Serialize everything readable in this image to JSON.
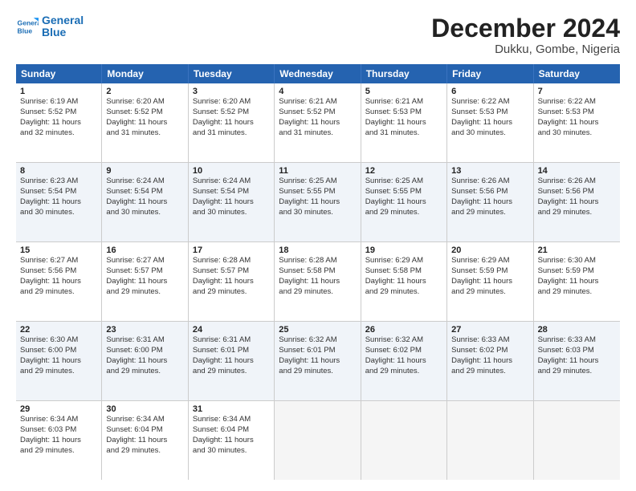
{
  "logo": {
    "text_general": "General",
    "text_blue": "Blue"
  },
  "title": "December 2024",
  "location": "Dukku, Gombe, Nigeria",
  "days_of_week": [
    "Sunday",
    "Monday",
    "Tuesday",
    "Wednesday",
    "Thursday",
    "Friday",
    "Saturday"
  ],
  "rows": [
    {
      "alt": false,
      "cells": [
        {
          "day": "1",
          "lines": [
            "Sunrise: 6:19 AM",
            "Sunset: 5:52 PM",
            "Daylight: 11 hours",
            "and 32 minutes."
          ]
        },
        {
          "day": "2",
          "lines": [
            "Sunrise: 6:20 AM",
            "Sunset: 5:52 PM",
            "Daylight: 11 hours",
            "and 31 minutes."
          ]
        },
        {
          "day": "3",
          "lines": [
            "Sunrise: 6:20 AM",
            "Sunset: 5:52 PM",
            "Daylight: 11 hours",
            "and 31 minutes."
          ]
        },
        {
          "day": "4",
          "lines": [
            "Sunrise: 6:21 AM",
            "Sunset: 5:52 PM",
            "Daylight: 11 hours",
            "and 31 minutes."
          ]
        },
        {
          "day": "5",
          "lines": [
            "Sunrise: 6:21 AM",
            "Sunset: 5:53 PM",
            "Daylight: 11 hours",
            "and 31 minutes."
          ]
        },
        {
          "day": "6",
          "lines": [
            "Sunrise: 6:22 AM",
            "Sunset: 5:53 PM",
            "Daylight: 11 hours",
            "and 30 minutes."
          ]
        },
        {
          "day": "7",
          "lines": [
            "Sunrise: 6:22 AM",
            "Sunset: 5:53 PM",
            "Daylight: 11 hours",
            "and 30 minutes."
          ]
        }
      ]
    },
    {
      "alt": true,
      "cells": [
        {
          "day": "8",
          "lines": [
            "Sunrise: 6:23 AM",
            "Sunset: 5:54 PM",
            "Daylight: 11 hours",
            "and 30 minutes."
          ]
        },
        {
          "day": "9",
          "lines": [
            "Sunrise: 6:24 AM",
            "Sunset: 5:54 PM",
            "Daylight: 11 hours",
            "and 30 minutes."
          ]
        },
        {
          "day": "10",
          "lines": [
            "Sunrise: 6:24 AM",
            "Sunset: 5:54 PM",
            "Daylight: 11 hours",
            "and 30 minutes."
          ]
        },
        {
          "day": "11",
          "lines": [
            "Sunrise: 6:25 AM",
            "Sunset: 5:55 PM",
            "Daylight: 11 hours",
            "and 30 minutes."
          ]
        },
        {
          "day": "12",
          "lines": [
            "Sunrise: 6:25 AM",
            "Sunset: 5:55 PM",
            "Daylight: 11 hours",
            "and 29 minutes."
          ]
        },
        {
          "day": "13",
          "lines": [
            "Sunrise: 6:26 AM",
            "Sunset: 5:56 PM",
            "Daylight: 11 hours",
            "and 29 minutes."
          ]
        },
        {
          "day": "14",
          "lines": [
            "Sunrise: 6:26 AM",
            "Sunset: 5:56 PM",
            "Daylight: 11 hours",
            "and 29 minutes."
          ]
        }
      ]
    },
    {
      "alt": false,
      "cells": [
        {
          "day": "15",
          "lines": [
            "Sunrise: 6:27 AM",
            "Sunset: 5:56 PM",
            "Daylight: 11 hours",
            "and 29 minutes."
          ]
        },
        {
          "day": "16",
          "lines": [
            "Sunrise: 6:27 AM",
            "Sunset: 5:57 PM",
            "Daylight: 11 hours",
            "and 29 minutes."
          ]
        },
        {
          "day": "17",
          "lines": [
            "Sunrise: 6:28 AM",
            "Sunset: 5:57 PM",
            "Daylight: 11 hours",
            "and 29 minutes."
          ]
        },
        {
          "day": "18",
          "lines": [
            "Sunrise: 6:28 AM",
            "Sunset: 5:58 PM",
            "Daylight: 11 hours",
            "and 29 minutes."
          ]
        },
        {
          "day": "19",
          "lines": [
            "Sunrise: 6:29 AM",
            "Sunset: 5:58 PM",
            "Daylight: 11 hours",
            "and 29 minutes."
          ]
        },
        {
          "day": "20",
          "lines": [
            "Sunrise: 6:29 AM",
            "Sunset: 5:59 PM",
            "Daylight: 11 hours",
            "and 29 minutes."
          ]
        },
        {
          "day": "21",
          "lines": [
            "Sunrise: 6:30 AM",
            "Sunset: 5:59 PM",
            "Daylight: 11 hours",
            "and 29 minutes."
          ]
        }
      ]
    },
    {
      "alt": true,
      "cells": [
        {
          "day": "22",
          "lines": [
            "Sunrise: 6:30 AM",
            "Sunset: 6:00 PM",
            "Daylight: 11 hours",
            "and 29 minutes."
          ]
        },
        {
          "day": "23",
          "lines": [
            "Sunrise: 6:31 AM",
            "Sunset: 6:00 PM",
            "Daylight: 11 hours",
            "and 29 minutes."
          ]
        },
        {
          "day": "24",
          "lines": [
            "Sunrise: 6:31 AM",
            "Sunset: 6:01 PM",
            "Daylight: 11 hours",
            "and 29 minutes."
          ]
        },
        {
          "day": "25",
          "lines": [
            "Sunrise: 6:32 AM",
            "Sunset: 6:01 PM",
            "Daylight: 11 hours",
            "and 29 minutes."
          ]
        },
        {
          "day": "26",
          "lines": [
            "Sunrise: 6:32 AM",
            "Sunset: 6:02 PM",
            "Daylight: 11 hours",
            "and 29 minutes."
          ]
        },
        {
          "day": "27",
          "lines": [
            "Sunrise: 6:33 AM",
            "Sunset: 6:02 PM",
            "Daylight: 11 hours",
            "and 29 minutes."
          ]
        },
        {
          "day": "28",
          "lines": [
            "Sunrise: 6:33 AM",
            "Sunset: 6:03 PM",
            "Daylight: 11 hours",
            "and 29 minutes."
          ]
        }
      ]
    },
    {
      "alt": false,
      "cells": [
        {
          "day": "29",
          "lines": [
            "Sunrise: 6:34 AM",
            "Sunset: 6:03 PM",
            "Daylight: 11 hours",
            "and 29 minutes."
          ]
        },
        {
          "day": "30",
          "lines": [
            "Sunrise: 6:34 AM",
            "Sunset: 6:04 PM",
            "Daylight: 11 hours",
            "and 29 minutes."
          ]
        },
        {
          "day": "31",
          "lines": [
            "Sunrise: 6:34 AM",
            "Sunset: 6:04 PM",
            "Daylight: 11 hours",
            "and 30 minutes."
          ]
        },
        {
          "day": "",
          "lines": []
        },
        {
          "day": "",
          "lines": []
        },
        {
          "day": "",
          "lines": []
        },
        {
          "day": "",
          "lines": []
        }
      ]
    }
  ]
}
